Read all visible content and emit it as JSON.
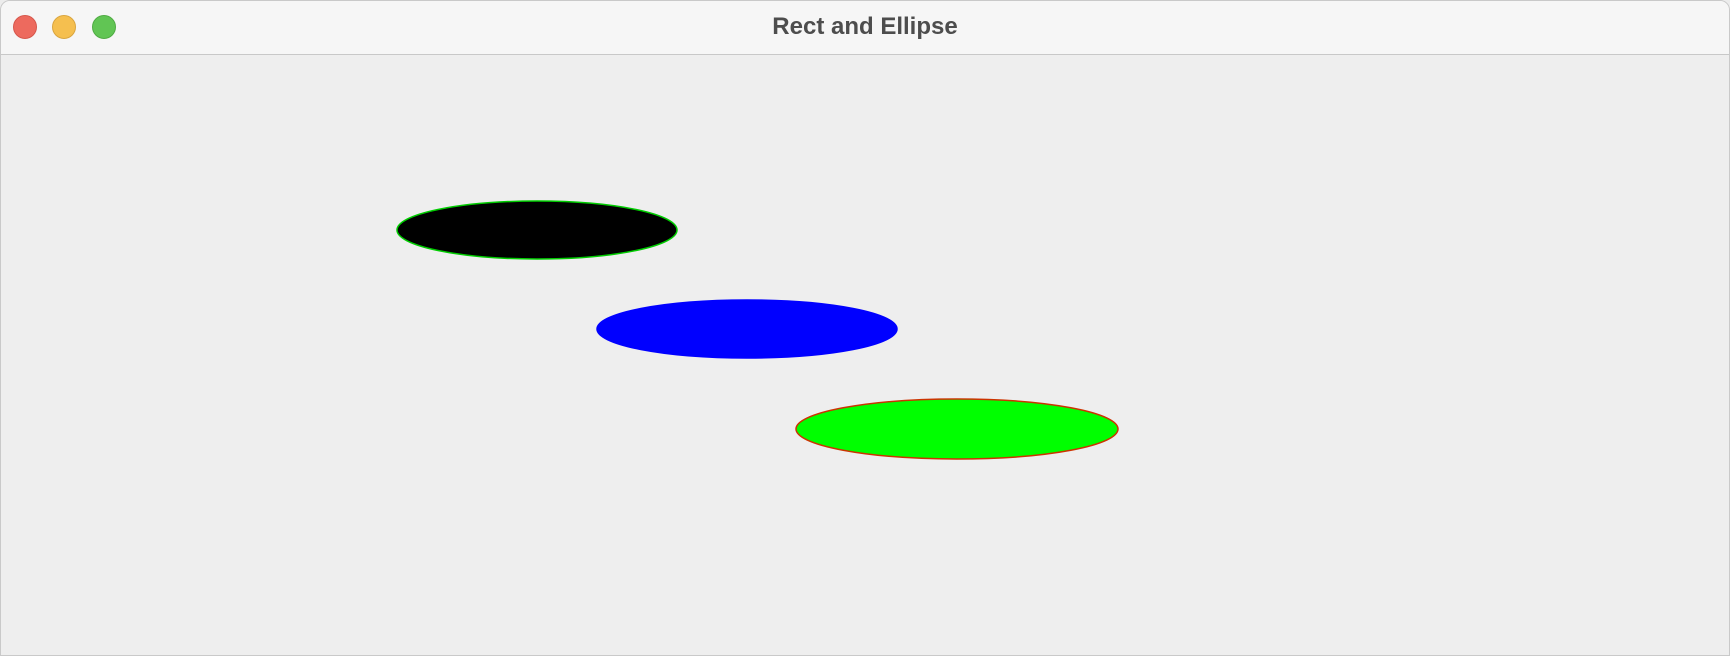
{
  "window": {
    "title": "Rect and Ellipse"
  },
  "titlebar_buttons": [
    {
      "name": "close",
      "color": "#ed6a5e"
    },
    {
      "name": "minimize",
      "color": "#f5bf4f"
    },
    {
      "name": "maximize",
      "color": "#61c554"
    }
  ],
  "canvas": {
    "background": "#eeeeee",
    "ellipses": [
      {
        "name": "black-ellipse",
        "fill": "#000000",
        "stroke": "#00cc00"
      },
      {
        "name": "blue-ellipse",
        "fill": "#0000ff",
        "stroke": "#0000ff"
      },
      {
        "name": "green-ellipse",
        "fill": "#00ff00",
        "stroke": "#cc3300"
      }
    ]
  }
}
